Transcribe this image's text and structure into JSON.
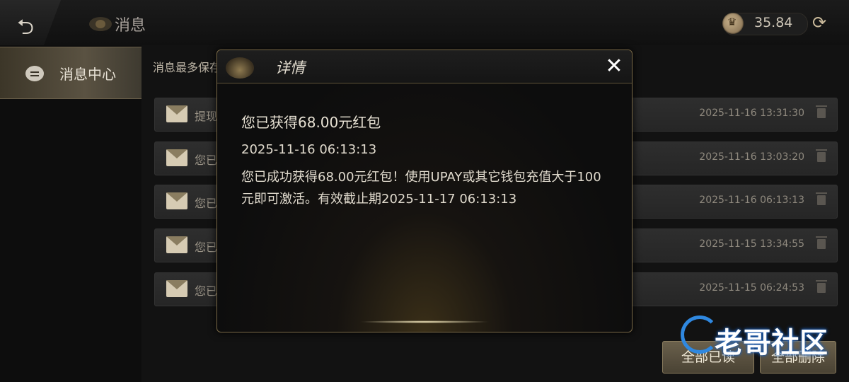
{
  "header": {
    "title": "消息",
    "balance": "35.84",
    "back_icon": "back-arrow-icon",
    "refresh_icon": "refresh-icon"
  },
  "sidebar": {
    "items": [
      {
        "label": "消息中心",
        "icon": "message-icon"
      }
    ]
  },
  "main": {
    "notice": "消息最多保存",
    "messages": [
      {
        "preview": "提现",
        "date": "2025-11-16 13:31:30"
      },
      {
        "preview": "您已",
        "date": "2025-11-16 13:03:20"
      },
      {
        "preview": "您已",
        "date": "2025-11-16 06:13:13"
      },
      {
        "preview": "您已",
        "date": "2025-11-15 13:34:55"
      },
      {
        "preview": "您已",
        "date": "2025-11-15 06:24:53"
      }
    ],
    "buttons": {
      "read_all": "全部已读",
      "delete_all": "全部删除"
    }
  },
  "dialog": {
    "title": "详情",
    "close_label": "✕",
    "heading": "您已获得68.00元红包",
    "time": "2025-11-16 06:13:13",
    "body": "您已成功获得68.00元红包！使用UPAY或其它钱包充值大于100元即可激活。有效截止期2025-11-17 06:13:13"
  },
  "watermark": {
    "text": "老哥社区"
  },
  "colors": {
    "accent": "#8a7c5e",
    "background": "#0b0b0b"
  }
}
